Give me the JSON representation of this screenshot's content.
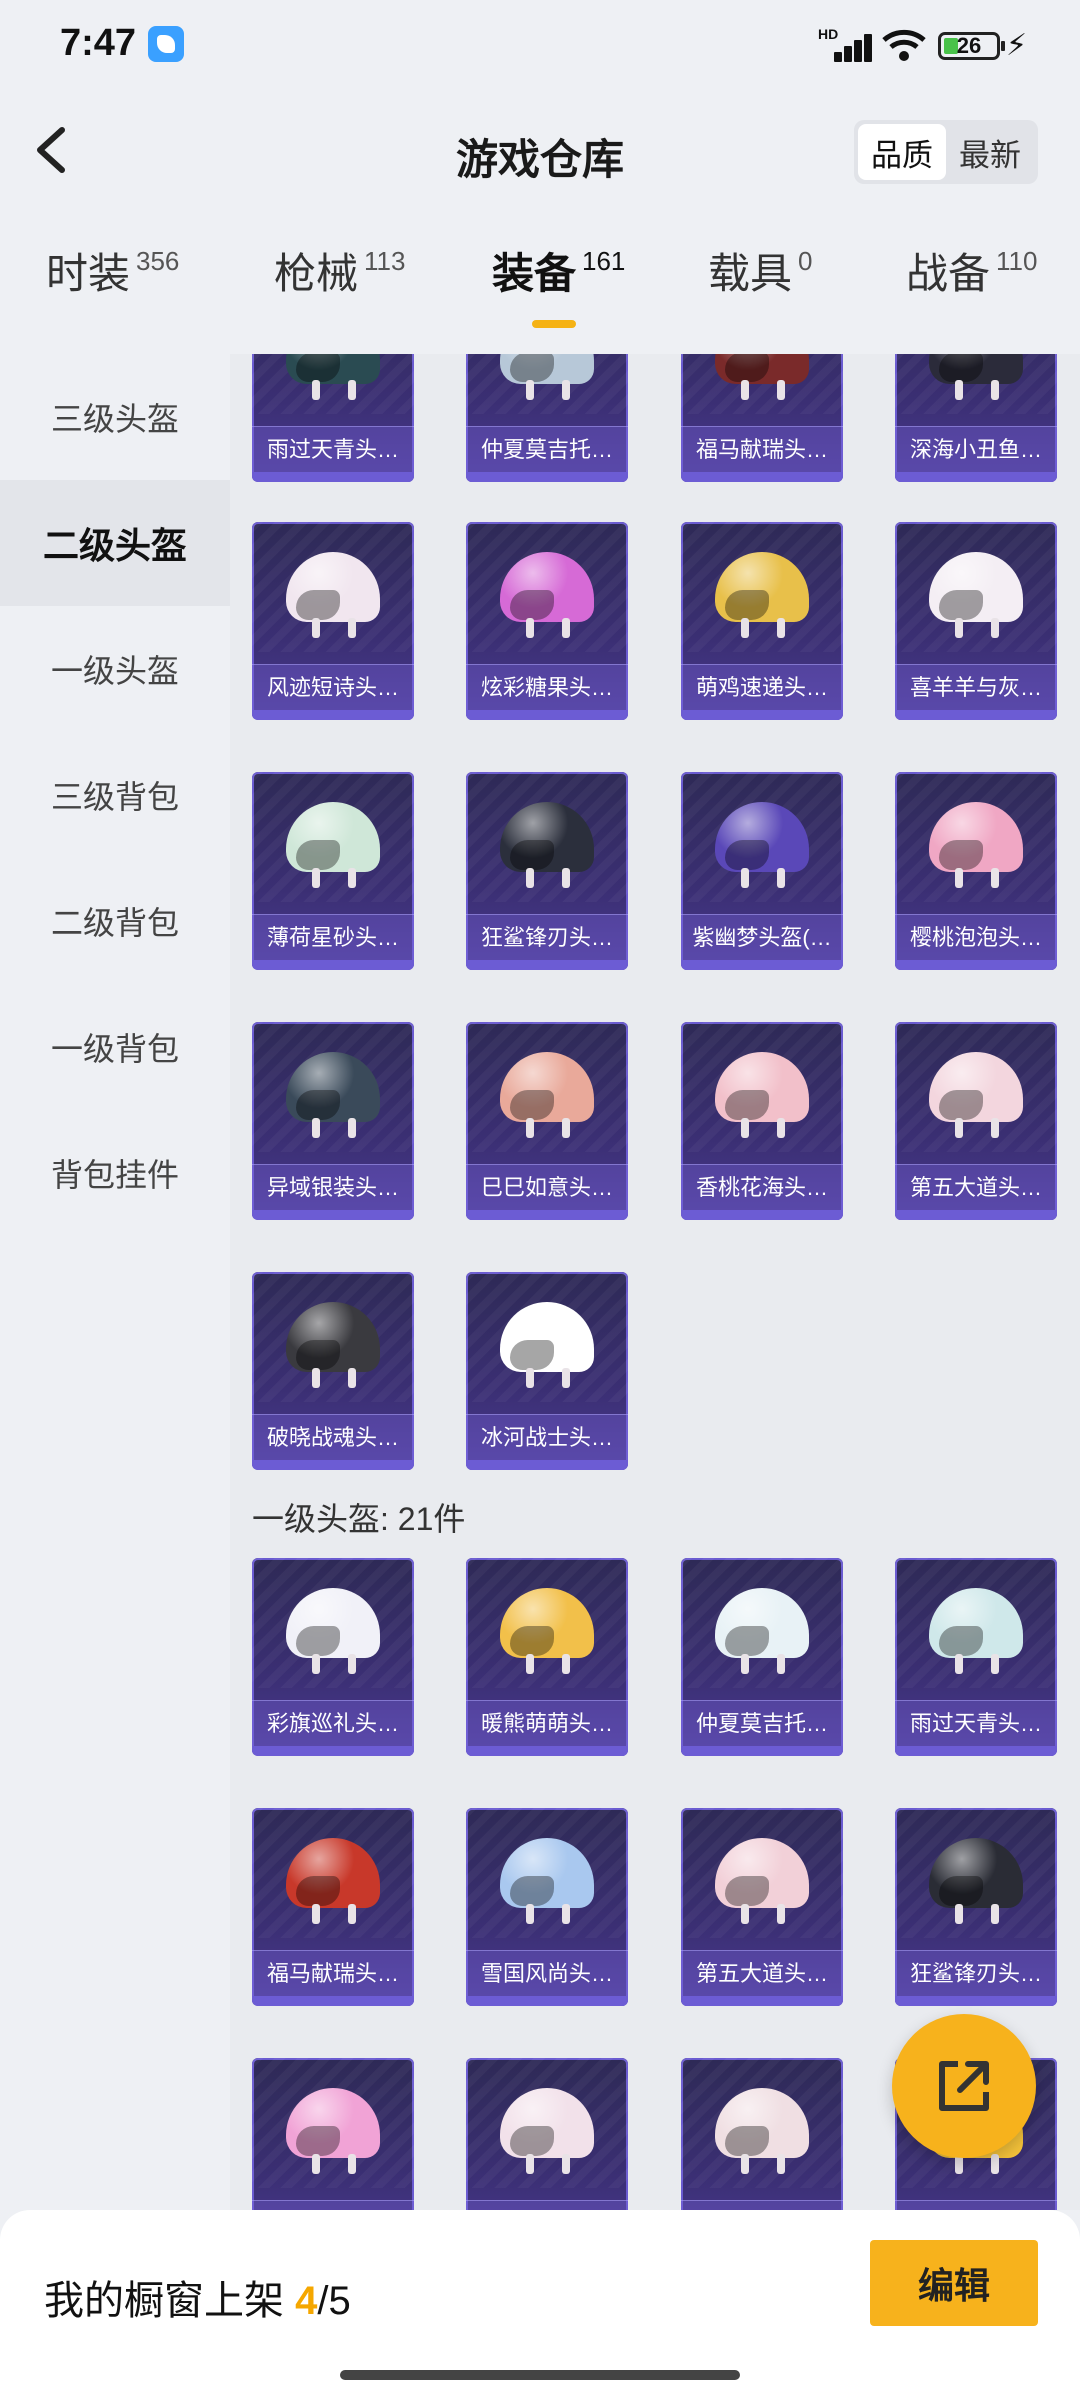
{
  "status": {
    "time": "7:47",
    "battery": "26",
    "network_label": "HD"
  },
  "header": {
    "title": "游戏仓库",
    "sort_options": [
      "品质",
      "最新"
    ],
    "sort_active": 0
  },
  "tabs": [
    {
      "label": "时装",
      "count": "356"
    },
    {
      "label": "枪械",
      "count": "113"
    },
    {
      "label": "装备",
      "count": "161"
    },
    {
      "label": "载具",
      "count": "0"
    },
    {
      "label": "战备",
      "count": "110"
    }
  ],
  "active_tab": 2,
  "sidebar": {
    "items": [
      "三级头盔",
      "二级头盔",
      "一级头盔",
      "三级背包",
      "二级背包",
      "一级背包",
      "背包挂件"
    ],
    "active": 1
  },
  "sections": [
    {
      "title": "",
      "items": [
        "雨过天青头…",
        "仲夏莫吉托…",
        "福马献瑞头…",
        "深海小丑鱼…"
      ]
    },
    {
      "title": "",
      "items": [
        "风迹短诗头…",
        "炫彩糖果头…",
        "萌鸡速递头…",
        "喜羊羊与灰…",
        "薄荷星砂头…",
        "狂鲨锋刃头…",
        "紫幽梦头盔(…",
        "樱桃泡泡头…",
        "异域银装头…",
        "巳巳如意头…",
        "香桃花海头…",
        "第五大道头…",
        "破晓战魂头…",
        "冰河战士头…"
      ]
    },
    {
      "title": "一级头盔: 21件",
      "items": [
        "彩旗巡礼头…",
        "暖熊萌萌头…",
        "仲夏莫吉托…",
        "雨过天青头…",
        "福马献瑞头…",
        "雪国风尚头…",
        "第五大道头…",
        "狂鲨锋刃头…",
        "",
        "",
        "",
        ""
      ]
    }
  ],
  "helmet_colors": [
    "#2a4b52",
    "#b7c8d8",
    "#7a2a2a",
    "#2b2b3a",
    "#f1e6ef",
    "#d66ad6",
    "#e8c04a",
    "#f4eef4",
    "#cfe7d8",
    "#2b2f3c",
    "#5a48b8",
    "#f0a7c4",
    "#3a4a5a",
    "#e9a99a",
    "#f2c0ca",
    "#f3d6de",
    "#3a3a3f",
    "#ffffff",
    "#f1f1f8",
    "#f2c04a",
    "#e8f2f6",
    "#cfe8ea",
    "#c8382a",
    "#a9c8ef",
    "#f2d0d8",
    "#2a2c35",
    "#f1a3d6",
    "#f2e1ea",
    "#f0dfe3",
    "#f4c23a"
  ],
  "showcase": {
    "label": "我的橱窗上架 ",
    "count": "4",
    "total": "/5"
  },
  "edit_label": "编辑"
}
